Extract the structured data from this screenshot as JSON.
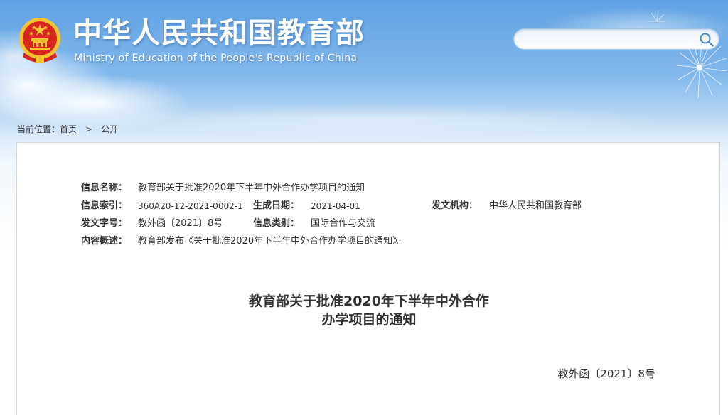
{
  "header": {
    "title": "中华人民共和国教育部",
    "subtitle": "Ministry of Education of the People's Republic of China"
  },
  "search": {
    "value": "",
    "placeholder": ""
  },
  "breadcrumb": {
    "prefix": "当前位置：",
    "items": [
      "首页",
      "公开"
    ],
    "separator": ">"
  },
  "meta": {
    "name_label": "信息名称：",
    "name_value": "教育部关于批准2020年下半年中外合作办学项目的通知",
    "index_label": "信息索引：",
    "index_value": "360A20-12-2021-0002-1",
    "date_label": "生成日期：",
    "date_value": "2021-04-01",
    "org_label": "发文机构：",
    "org_value": "中华人民共和国教育部",
    "docno_label": "发文字号：",
    "docno_value": "教外函〔2021〕8号",
    "category_label": "信息类别：",
    "category_value": "国际合作与交流",
    "summary_label": "内容概述：",
    "summary_value": "教育部发布《关于批准2020年下半年中外合作办学项目的通知》。"
  },
  "document": {
    "title_line1": "教育部关于批准2020年下半年中外合作",
    "title_line2": "办学项目的通知",
    "number": "教外函〔2021〕8号"
  },
  "colors": {
    "sky_top": "#5ea1e3",
    "text": "#333333",
    "panel_border": "#d6d6d6",
    "emblem_red": "#d7261e",
    "emblem_gold": "#f4c430"
  },
  "icons": {
    "emblem": "national-emblem-icon",
    "search": "search-icon"
  }
}
